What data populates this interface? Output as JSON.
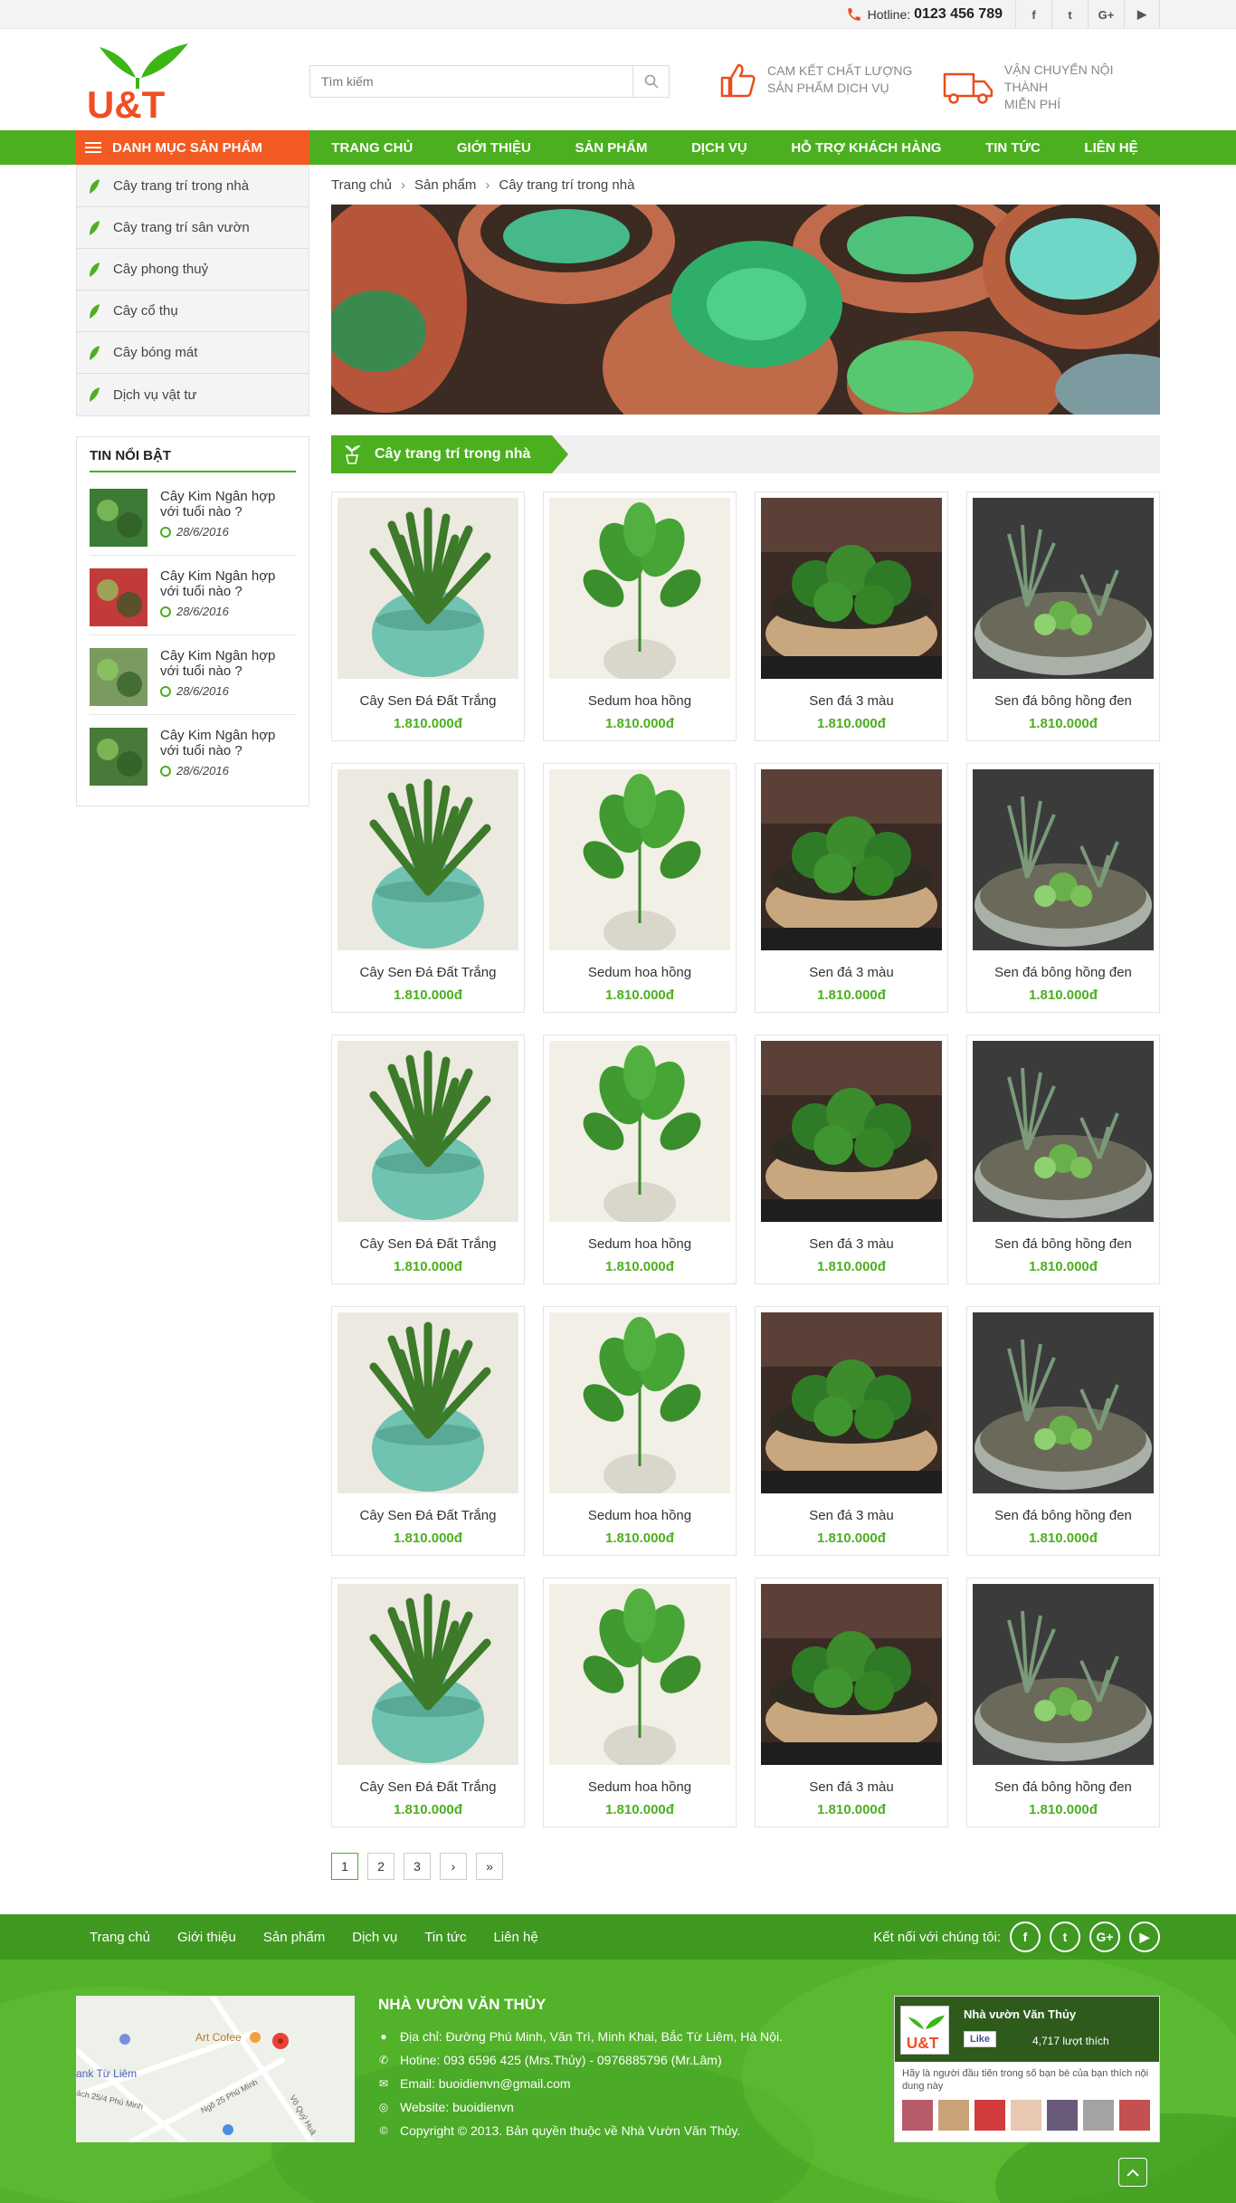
{
  "topbar": {
    "hotline_label": "Hotline:",
    "hotline_number": "0123 456 789",
    "social": [
      {
        "icon": "facebook-icon",
        "glyph": "f"
      },
      {
        "icon": "twitter-icon",
        "glyph": "t"
      },
      {
        "icon": "google-plus-icon",
        "glyph": "G+"
      },
      {
        "icon": "youtube-icon",
        "glyph": "▶"
      }
    ]
  },
  "header": {
    "logo_text": "U&T",
    "search_placeholder": "Tìm kiếm",
    "usp": [
      {
        "icon": "thumbs-up-icon",
        "line1": "Cam kết chất lượng",
        "line2": "sản phẩm dịch vụ"
      },
      {
        "icon": "delivery-truck-icon",
        "line1": "Vận chuyển nội thành",
        "line2": "miễn phí"
      }
    ]
  },
  "nav": {
    "category_button": "Danh mục sản phẩm",
    "items": [
      "Trang chủ",
      "Giới thiệu",
      "Sản phẩm",
      "Dịch vụ",
      "Hỗ trợ khách hàng",
      "Tin tức",
      "Liên hệ"
    ]
  },
  "sidebar": {
    "categories": [
      "Cây trang trí trong nhà",
      "Cây trang trí sân vườn",
      "Cây phong thuỷ",
      "Cây cổ thụ",
      "Cây bóng mát",
      "Dịch vụ vật tư"
    ],
    "news_title": "Tin nổi bật",
    "news": [
      {
        "title": "Cây Kim Ngân hợp với tuổi nào ?",
        "date": "28/6/2016"
      },
      {
        "title": "Cây Kim Ngân hợp với tuổi nào ?",
        "date": "28/6/2016"
      },
      {
        "title": "Cây Kim Ngân hợp với tuổi nào ?",
        "date": "28/6/2016"
      },
      {
        "title": "Cây Kim Ngân hợp với tuổi nào ?",
        "date": "28/6/2016"
      }
    ]
  },
  "breadcrumb": [
    "Trang chủ",
    "Sản phẩm",
    "Cây trang trí trong nhà"
  ],
  "section_title": "Cây trang trí trong nhà",
  "products": [
    {
      "name": "Cây Sen Đá Đất Trắng",
      "price": "1.810.000đ"
    },
    {
      "name": "Sedum hoa hồng",
      "price": "1.810.000đ"
    },
    {
      "name": "Sen đá 3 màu",
      "price": "1.810.000đ"
    },
    {
      "name": "Sen đá bông hồng đen",
      "price": "1.810.000đ"
    },
    {
      "name": "Cây Sen Đá Đất Trắng",
      "price": "1.810.000đ"
    },
    {
      "name": "Sedum hoa hồng",
      "price": "1.810.000đ"
    },
    {
      "name": "Sen đá 3 màu",
      "price": "1.810.000đ"
    },
    {
      "name": "Sen đá bông hồng đen",
      "price": "1.810.000đ"
    },
    {
      "name": "Cây Sen Đá Đất Trắng",
      "price": "1.810.000đ"
    },
    {
      "name": "Sedum hoa hồng",
      "price": "1.810.000đ"
    },
    {
      "name": "Sen đá 3 màu",
      "price": "1.810.000đ"
    },
    {
      "name": "Sen đá bông hồng đen",
      "price": "1.810.000đ"
    },
    {
      "name": "Cây Sen Đá Đất Trắng",
      "price": "1.810.000đ"
    },
    {
      "name": "Sedum hoa hồng",
      "price": "1.810.000đ"
    },
    {
      "name": "Sen đá 3 màu",
      "price": "1.810.000đ"
    },
    {
      "name": "Sen đá bông hồng đen",
      "price": "1.810.000đ"
    },
    {
      "name": "Cây Sen Đá Đất Trắng",
      "price": "1.810.000đ"
    },
    {
      "name": "Sedum hoa hồng",
      "price": "1.810.000đ"
    },
    {
      "name": "Sen đá 3 màu",
      "price": "1.810.000đ"
    },
    {
      "name": "Sen đá bông hồng đen",
      "price": "1.810.000đ"
    }
  ],
  "pagination": [
    "1",
    "2",
    "3",
    "›",
    "»"
  ],
  "footer": {
    "nav": [
      "Trang chủ",
      "Giới thiệu",
      "Sản phẩm",
      "Dịch vụ",
      "Tin tức",
      "Liên hệ"
    ],
    "connect_label": "Kết nối với chúng tôi:",
    "company_name": "Nhà vườn Văn Thủy",
    "address": "Địa chỉ: Đường Phú Minh, Văn Trì, Minh Khai, Bắc Từ Liêm, Hà Nội.",
    "hotline": "Hotine: 093 6596 425 (Mrs.Thủy) - 0976885796 (Mr.Lâm)",
    "email": "Email: buoidienvn@gmail.com",
    "website": "Website: buoidienvn",
    "copyright": "Copyright © 2013. Bản quyền thuộc về Nhà Vườn Văn Thủy.",
    "map_labels": [
      "Art Cofee",
      "ank Từ Liêm",
      "Ngõ 25 Phú Minh",
      "ách 25/4 Phú Minh",
      "Võ Quý Huâ"
    ],
    "fb_page_name": "Nhà vườn Văn Thủy",
    "fb_like": "Like",
    "fb_count": "4,717 lượt thích",
    "fb_note": "Hãy là người đầu tiên trong số bạn bè của bạn thích nội dung này"
  },
  "colors": {
    "brand_green": "#4caf1f",
    "accent_orange": "#f15a22"
  }
}
